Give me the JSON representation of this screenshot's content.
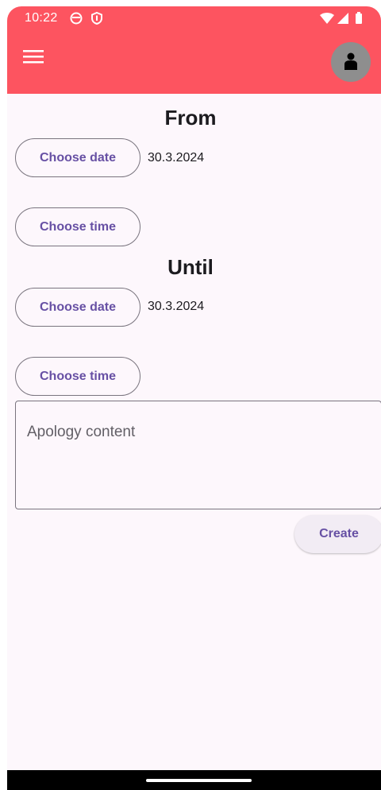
{
  "status_bar": {
    "time": "10:22",
    "icons": [
      "record-icon",
      "shield-icon",
      "wifi-icon",
      "signal-icon",
      "battery-icon"
    ]
  },
  "app_bar": {
    "color": "#fd5460",
    "menu_icon": "hamburger-menu-icon",
    "avatar_icon": "person-icon"
  },
  "from": {
    "heading": "From",
    "date_button": "Choose date",
    "date_value": "30.3.2024",
    "time_button": "Choose time"
  },
  "until": {
    "heading": "Until",
    "date_button": "Choose date",
    "date_value": "30.3.2024",
    "time_button": "Choose time"
  },
  "content_field": {
    "placeholder": "Apology content"
  },
  "create_button": "Create"
}
